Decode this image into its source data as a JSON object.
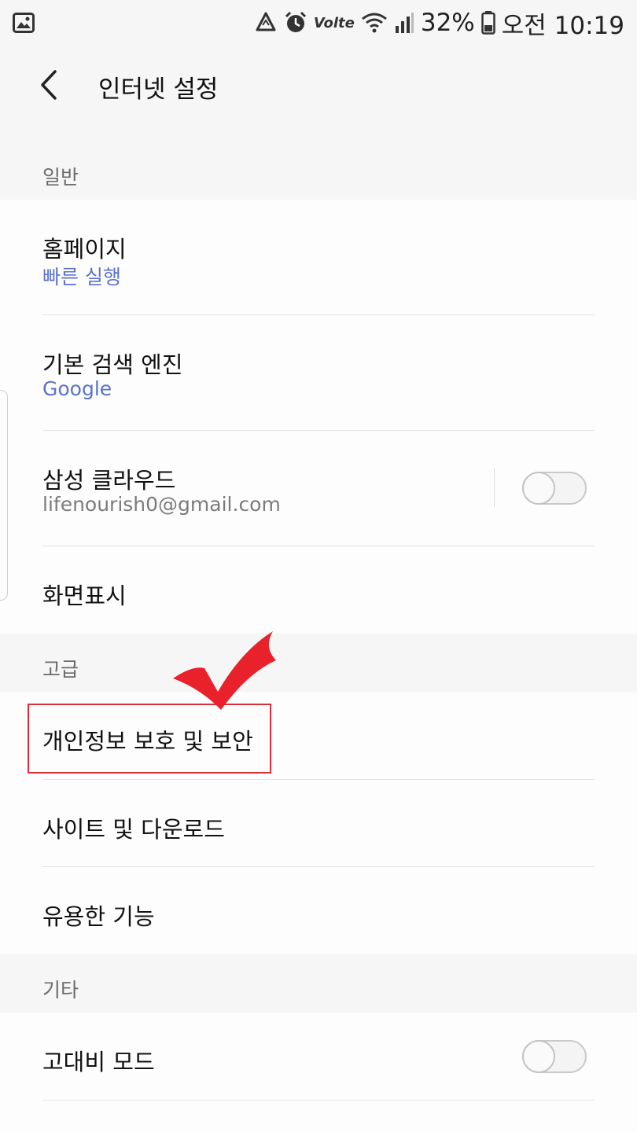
{
  "status_bar": {
    "battery_percent": "32%",
    "time": "오전 10:19",
    "volte_label": "Volte",
    "icons": [
      "gallery-icon",
      "recycle-icon",
      "alarm-icon",
      "volte-icon",
      "wifi-icon",
      "signal-icon",
      "battery-icon"
    ]
  },
  "header": {
    "title": "인터넷 설정",
    "back_icon": "chevron-left-icon"
  },
  "sections": {
    "general": {
      "title": "일반",
      "items": [
        {
          "title": "홈페이지",
          "subtitle": "빠른 실행"
        },
        {
          "title": "기본 검색 엔진",
          "subtitle": "Google"
        },
        {
          "title": "삼성 클라우드",
          "subtitle": "lifenourish0@gmail.com",
          "toggle_on": false
        },
        {
          "title": "화면표시"
        }
      ]
    },
    "advanced": {
      "title": "고급",
      "items": [
        {
          "title": "개인정보 보호 및 보안",
          "highlighted": true
        },
        {
          "title": "사이트 및 다운로드"
        },
        {
          "title": "유용한 기능"
        }
      ]
    },
    "other": {
      "title": "기타",
      "items": [
        {
          "title": "고대비 모드",
          "toggle_on": false
        }
      ]
    }
  },
  "colors": {
    "accent_blue": "#5b72c9",
    "annotation_red": "#e8212b",
    "background": "#f6f6f6",
    "card": "#fdfdfd"
  }
}
